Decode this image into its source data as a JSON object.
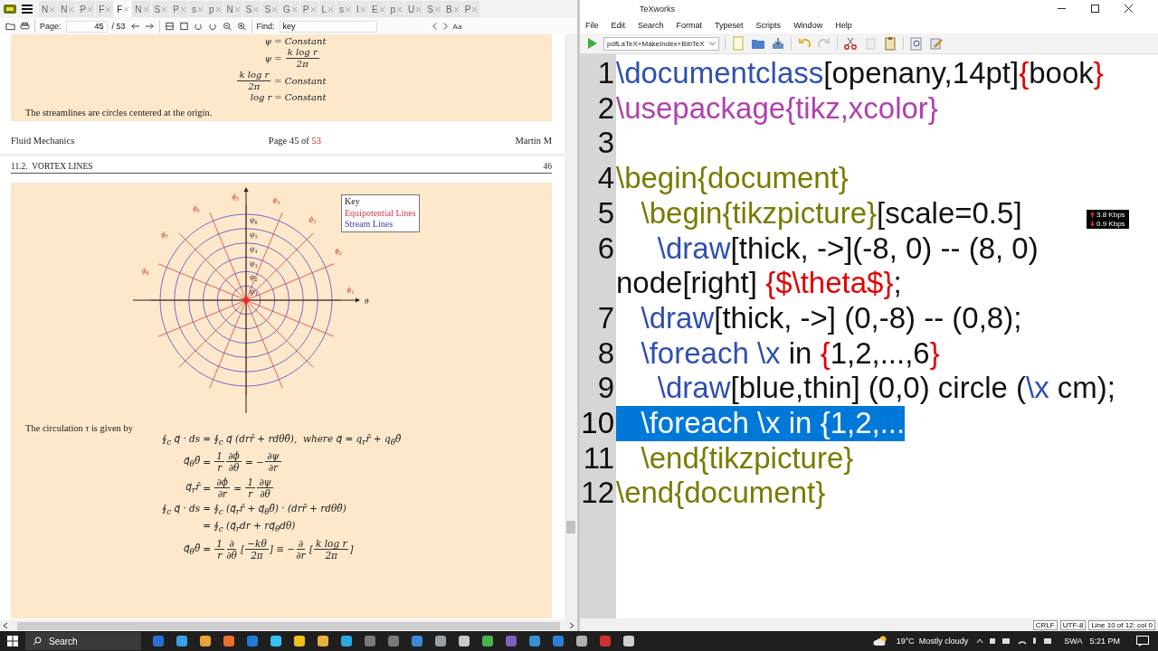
{
  "pdf_viewer": {
    "tabs": [
      {
        "label": "N",
        "selected": false
      },
      {
        "label": "N",
        "selected": false
      },
      {
        "label": "P",
        "selected": false
      },
      {
        "label": "F",
        "selected": false
      },
      {
        "label": "F",
        "selected": true
      },
      {
        "label": "N",
        "selected": false
      },
      {
        "label": "S",
        "selected": false
      },
      {
        "label": "P",
        "selected": false
      },
      {
        "label": "s",
        "selected": false
      },
      {
        "label": "p",
        "selected": false
      },
      {
        "label": "N",
        "selected": false
      },
      {
        "label": "S",
        "selected": false
      },
      {
        "label": "S",
        "selected": false
      },
      {
        "label": "G",
        "selected": false
      },
      {
        "label": "P",
        "selected": false
      },
      {
        "label": "L",
        "selected": false
      },
      {
        "label": "s",
        "selected": false
      },
      {
        "label": "I",
        "selected": false
      },
      {
        "label": "E",
        "selected": false
      },
      {
        "label": "p",
        "selected": false
      },
      {
        "label": "U",
        "selected": false
      },
      {
        "label": "S",
        "selected": false
      },
      {
        "label": "B",
        "selected": false
      },
      {
        "label": "P",
        "selected": false
      }
    ],
    "toolbar": {
      "page_label": "Page:",
      "page": "45",
      "page_total": "/ 53",
      "find_label": "Find:",
      "find_value": "key",
      "match_case": "Aa"
    },
    "page_45": {
      "equations": [
        {
          "lhs": [
            "ψ"
          ],
          "rhs": [
            "= Constant"
          ]
        },
        {
          "lhs": [
            "ψ"
          ],
          "rhs": [
            "= ",
            {
              "num": "k log r",
              "den": "2π"
            }
          ]
        },
        {
          "lhs": [
            {
              "num": "k log r",
              "den": "2π"
            }
          ],
          "rhs": [
            "= Constant"
          ]
        },
        {
          "lhs": [
            "log r"
          ],
          "rhs": [
            "= Constant"
          ]
        }
      ],
      "text": "The streamlines are circles centered at the origin.",
      "footer": {
        "left": "Fluid Mechanics",
        "center": "Page 45 of",
        "center_link": "53",
        "right": "Martin M"
      }
    },
    "page_46": {
      "header": {
        "section": "11.2.  VORTEX LINES",
        "page": "46"
      },
      "figure": {
        "phi_labels": [
          "ϕ₅",
          "ϕ₆",
          "ϕ₄",
          "ϕ₇",
          "ϕ₃",
          "ϕ₈",
          "ϕ₂",
          "ϕ₁"
        ],
        "psi_labels": [
          "ψ₆",
          "ψ₅",
          "ψ₄",
          "ψ₃",
          "ψ₂",
          "ψ₁"
        ],
        "axis_label": "θ",
        "legend": [
          {
            "kind": "title",
            "label": "Key"
          },
          {
            "kind": "equipotential",
            "label": "Equipotential Lines"
          },
          {
            "kind": "stream",
            "label": "Stream Lines"
          }
        ]
      },
      "text": "The circulation *τ* is given by",
      "equations": [
        {
          "lhs": [
            "∮$_{c}$ q⃗ · ds"
          ],
          "rhs": [
            "= ∮$_{c}$ q⃗ (drr̂ + rdθθ̂),  where q⃗ = q$_{r}$r̂ + q$_{θ}$θ̂"
          ]
        },
        {
          "lhs": [
            "q⃗$_{θ}$θ̂"
          ],
          "rhs": [
            "= ",
            {
              "num": "1",
              "den": "r"
            },
            {
              "num": "∂ϕ",
              "den": "∂θ"
            },
            " = −",
            {
              "num": "∂ψ",
              "den": "∂r"
            }
          ]
        },
        {
          "lhs": [
            "q⃗$_{r}$r̂"
          ],
          "rhs": [
            "= ",
            {
              "num": "∂ϕ",
              "den": "∂r"
            },
            " = ",
            {
              "num": "1",
              "den": "r"
            },
            {
              "num": "∂ψ",
              "den": "∂θ"
            }
          ]
        },
        {
          "lhs": [
            "∮$_{c}$ q⃗ · ds"
          ],
          "rhs": [
            "= ∮$_{c}$ (q⃗$_{r}$r̂ + q⃗$_{θ}$θ̂) · (drr̂ + rdθθ̂)"
          ]
        },
        {
          "rhs": [
            "= ∮$_{c}$ (q⃗$_{r}$dr + rq⃗$_{θ}$dθ)"
          ]
        },
        {
          "lhs": [
            "q⃗$_{θ}$θ̂"
          ],
          "rhs": [
            "= ",
            {
              "num": "1",
              "den": "r"
            },
            {
              "num": "∂",
              "den": "∂θ"
            },
            " [",
            {
              "num": "−kθ",
              "den": "2π"
            },
            "] ≡ −",
            {
              "num": "∂",
              "den": "∂r"
            },
            " [",
            {
              "num": "k log r",
              "den": "2π"
            },
            "]"
          ]
        }
      ]
    }
  },
  "editor_window": {
    "title": "TeXworks",
    "menu": [
      "File",
      "Edit",
      "Search",
      "Format",
      "Typeset",
      "Scripts",
      "Window",
      "Help"
    ],
    "engine": "pdfLaTeX+MakeIndex+BibTeX",
    "lines": [
      {
        "number": "1",
        "selected": false,
        "segments": [
          {
            "kind": "command",
            "text": "\\documentclass"
          },
          {
            "kind": "text",
            "text": "[openany,14pt]"
          },
          {
            "kind": "brace",
            "text": "{"
          },
          {
            "kind": "text",
            "text": "book"
          },
          {
            "kind": "brace",
            "text": "}"
          }
        ]
      },
      {
        "number": "2",
        "selected": false,
        "segments": [
          {
            "kind": "package",
            "text": "\\usepackage{tikz,xcolor}"
          }
        ]
      },
      {
        "number": "3",
        "selected": false
      },
      {
        "number": "4",
        "selected": false,
        "segments": [
          {
            "kind": "environment",
            "text": "\\begin{document}"
          }
        ]
      },
      {
        "number": "5",
        "selected": false,
        "segments": [
          {
            "kind": "environment",
            "text": "   \\begin{tikzpicture}"
          },
          {
            "kind": "text",
            "text": "[scale=0.5]"
          }
        ]
      },
      {
        "number": "6",
        "selected": false,
        "segments": [
          {
            "kind": "command",
            "text": "     \\draw"
          },
          {
            "kind": "text",
            "text": "[thick, ->](-8, 0) -- (8, 0) node[right] "
          },
          {
            "kind": "math",
            "text": "{$\\theta$}"
          },
          {
            "kind": "text",
            "text": ";"
          }
        ]
      },
      {
        "number": "7",
        "selected": false,
        "segments": [
          {
            "kind": "command",
            "text": "   \\draw"
          },
          {
            "kind": "text",
            "text": "[thick, ->] (0,-8) -- (0,8);"
          }
        ]
      },
      {
        "number": "8",
        "selected": false,
        "segments": [
          {
            "kind": "command",
            "text": "   \\foreach \\x"
          },
          {
            "kind": "text",
            "text": " in "
          },
          {
            "kind": "brace",
            "text": "{"
          },
          {
            "kind": "text",
            "text": "1,2,...,6"
          },
          {
            "kind": "brace",
            "text": "}"
          }
        ]
      },
      {
        "number": "9",
        "selected": false,
        "segments": [
          {
            "kind": "command",
            "text": "     \\draw"
          },
          {
            "kind": "text",
            "text": "[blue,thin] (0,0) circle ("
          },
          {
            "kind": "command",
            "text": "\\x"
          },
          {
            "kind": "text",
            "text": " cm);"
          }
        ]
      },
      {
        "number": "10",
        "selected": true,
        "segments": [
          {
            "kind": "command",
            "text": "   \\foreach \\x"
          },
          {
            "kind": "text",
            "text": " in "
          },
          {
            "kind": "brace",
            "text": "{"
          },
          {
            "kind": "text",
            "text": "1,2,..."
          }
        ]
      },
      {
        "number": "11",
        "selected": false,
        "segments": [
          {
            "kind": "environment",
            "text": "   \\end{tikzpicture}"
          }
        ]
      },
      {
        "number": "12",
        "selected": false,
        "segments": [
          {
            "kind": "environment",
            "text": "\\end{document}"
          }
        ]
      }
    ],
    "status": [
      "CRLF",
      "UTF-8",
      "Line 10 of 12; col 0"
    ]
  },
  "network_meter": {
    "upload": "3.8 Kbps",
    "download": "0.9 Kbps"
  },
  "taskbar": {
    "search": "Search",
    "weather": "19°C  Mostly cloudy",
    "language": "SWA",
    "time": "5:21 PM"
  }
}
